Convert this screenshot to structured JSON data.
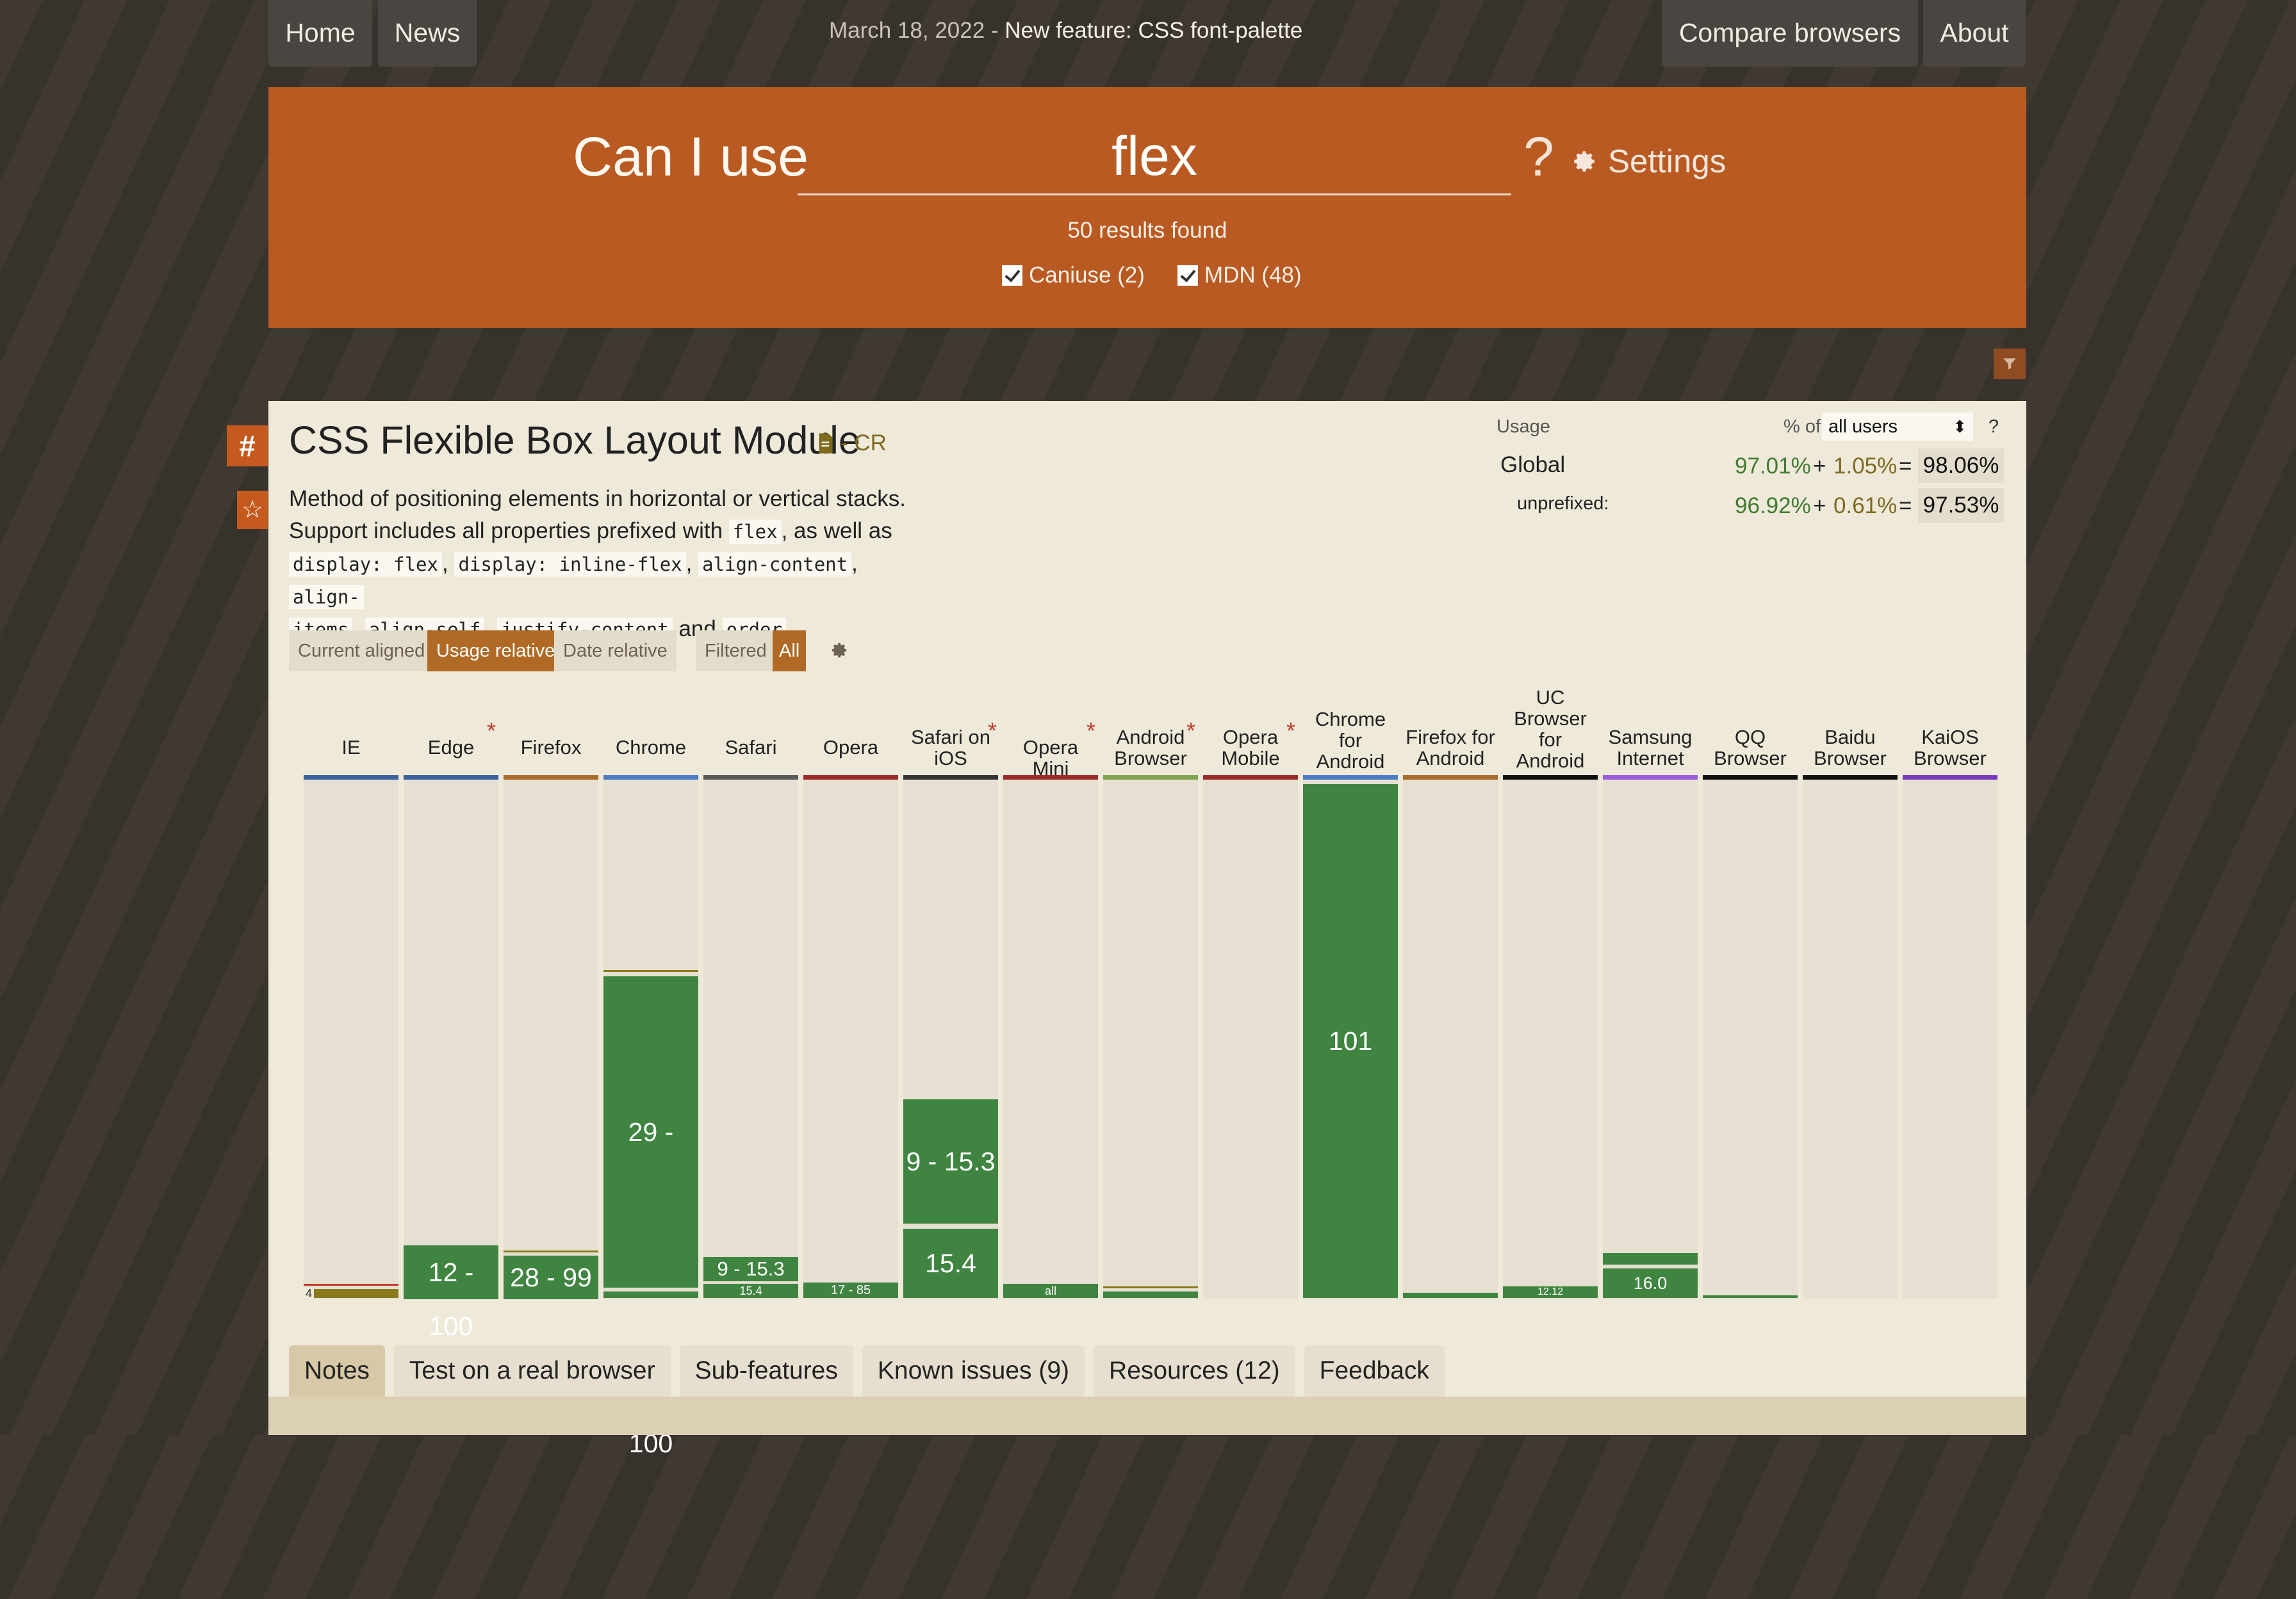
{
  "nav": {
    "home": "Home",
    "news": "News",
    "compare": "Compare browsers",
    "about": "About"
  },
  "announcement": {
    "date": "March 18, 2022",
    "separator": " - ",
    "text": "New feature: CSS font-palette"
  },
  "search": {
    "prefix": "Can I use",
    "query": "flex",
    "suffix": "?",
    "settings_label": "Settings",
    "results": "50 results found",
    "filter_caniuse": "Caniuse (2)",
    "filter_mdn": "MDN (48)"
  },
  "feature": {
    "title": "CSS Flexible Box Layout Module",
    "status": "- CR",
    "desc_line1": "Method of positioning elements in horizontal or vertical stacks.",
    "desc_line2a": "Support includes all properties prefixed with",
    "desc_code_flex": "flex",
    "desc_line2b": ", as well as",
    "code1": "display: flex",
    "code2": "display: inline-flex",
    "code3": "align-content",
    "code4a": "align-",
    "code4b": "items",
    "code5": "align-self",
    "code6": "justify-content",
    "and": "and",
    "code7": "order"
  },
  "usage": {
    "label": "Usage",
    "pct_of": "% of",
    "users_select": "all users",
    "help": "?",
    "global_label": "Global",
    "global_a": "97.01%",
    "global_b": "1.05%",
    "global_total": "98.06%",
    "unprefixed_label": "unprefixed:",
    "unprefixed_a": "96.92%",
    "unprefixed_b": "0.61%",
    "unprefixed_total": "97.53%",
    "plus": "+",
    "equals": "="
  },
  "view_toggles": {
    "current_aligned": "Current aligned",
    "usage_relative": "Usage relative",
    "date_relative": "Date relative",
    "filtered": "Filtered",
    "all": "All"
  },
  "browsers": [
    {
      "name_l1": "IE",
      "name_l2": "",
      "color": "#3a5f9c"
    },
    {
      "name_l1": "Edge",
      "name_l2": "",
      "color": "#3a5f9c"
    },
    {
      "name_l1": "Firefox",
      "name_l2": "",
      "color": "#a66a2a"
    },
    {
      "name_l1": "Chrome",
      "name_l2": "",
      "color": "#4a7bc4"
    },
    {
      "name_l1": "Safari",
      "name_l2": "",
      "color": "#5a5a5a"
    },
    {
      "name_l1": "Opera",
      "name_l2": "",
      "color": "#9a2a2a"
    },
    {
      "name_l1": "Safari on",
      "name_l2": "iOS",
      "color": "#333333"
    },
    {
      "name_l1": "Opera Mini",
      "name_l2": "",
      "color": "#9a2a2a"
    },
    {
      "name_l1": "Android",
      "name_l2": "Browser",
      "color": "#7fa34a"
    },
    {
      "name_l1": "Opera",
      "name_l2": "Mobile",
      "color": "#9a2a2a"
    },
    {
      "name_l1": "Chrome",
      "name_l2": "for",
      "name_l3": "Android",
      "color": "#4a7bc4"
    },
    {
      "name_l1": "Firefox for",
      "name_l2": "Android",
      "color": "#a66a2a"
    },
    {
      "name_l1": "UC",
      "name_l2": "Browser",
      "name_l3": "for",
      "name_l4": "Android",
      "color": "#111111"
    },
    {
      "name_l1": "Samsung",
      "name_l2": "Internet",
      "color": "#9a5ae0"
    },
    {
      "name_l1": "QQ",
      "name_l2": "Browser",
      "color": "#111111"
    },
    {
      "name_l1": "Baidu",
      "name_l2": "Browser",
      "color": "#111111"
    },
    {
      "name_l1": "KaiOS",
      "name_l2": "Browser",
      "color": "#7a3ac0"
    }
  ],
  "versions": {
    "ie_small": "4",
    "edge": "12 - 100",
    "firefox": "28 - 99",
    "chrome": "29 - 100",
    "safari": "9 - 15.3",
    "safari_small": "15.4",
    "opera": "17 - 85",
    "ios_old": "9 - 15.3",
    "ios_new": "15.4",
    "opera_mini": "all",
    "chrome_android": "101",
    "uc": "12.12",
    "samsung": "16.0"
  },
  "tabs": {
    "notes": "Notes",
    "test": "Test on a real browser",
    "sub": "Sub-features",
    "issues": "Known issues (9)",
    "resources": "Resources (12)",
    "feedback": "Feedback"
  },
  "colors": {
    "supported": "#3f8440",
    "partial": "#8a7a1e",
    "banner": "#b85a22",
    "accent": "#b06a25"
  }
}
